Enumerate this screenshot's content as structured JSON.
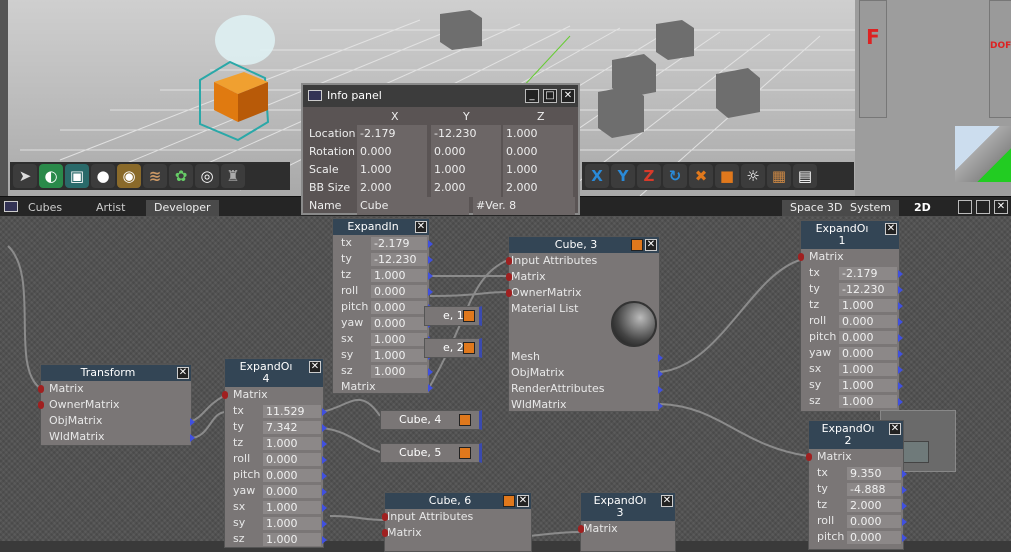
{
  "colors": {
    "accent": "#e0781c",
    "node_title": "#334555",
    "pin_in": "#a02020",
    "pin_out": "#4050e0"
  },
  "toolbar": {
    "icons": [
      "arrow-select-icon",
      "rotate-sphere-icon",
      "cube-icon",
      "bomb-icon",
      "sphere-icon",
      "grass-icon",
      "palette-icon",
      "tire-icon",
      "robot-icon"
    ],
    "right_icons": [
      "X",
      "Y",
      "Z"
    ]
  },
  "right_panel": {
    "letter": "F",
    "label1": "DOF"
  },
  "tabs": {
    "window_title": "Cubes",
    "artist": "Artist",
    "developer": "Developer",
    "space3d": "Space 3D",
    "system": "System",
    "mode2d": "2D"
  },
  "info_panel": {
    "title": "Info panel",
    "headers": [
      "X",
      "Y",
      "Z"
    ],
    "rows": [
      {
        "label": "Location",
        "x": "-2.179",
        "y": "-12.230",
        "z": "1.000"
      },
      {
        "label": "Rotation",
        "x": "0.000",
        "y": "0.000",
        "z": "0.000"
      },
      {
        "label": "Scale",
        "x": "1.000",
        "y": "1.000",
        "z": "1.000"
      },
      {
        "label": "BB Size",
        "x": "2.000",
        "y": "2.000",
        "z": "2.000"
      }
    ],
    "name_label": "Name",
    "name_value": "Cube",
    "version": "#Ver. 8"
  },
  "nodes": {
    "transform": {
      "title": "Transform",
      "ports": [
        "Matrix",
        "OwnerMatrix",
        "ObjMatrix",
        "WldMatrix"
      ]
    },
    "expand_in": {
      "title": "ExpandIn",
      "params": [
        [
          "tx",
          "-2.179"
        ],
        [
          "ty",
          "-12.230"
        ],
        [
          "tz",
          "1.000"
        ],
        [
          "roll",
          "0.000"
        ],
        [
          "pitch",
          "0.000"
        ],
        [
          "yaw",
          "0.000"
        ],
        [
          "sx",
          "1.000"
        ],
        [
          "sy",
          "1.000"
        ],
        [
          "sz",
          "1.000"
        ]
      ],
      "out": "Matrix"
    },
    "expand4": {
      "title": "ExpandOı",
      "num": "4",
      "matrix": "Matrix",
      "params": [
        [
          "tx",
          "11.529"
        ],
        [
          "ty",
          "7.342"
        ],
        [
          "tz",
          "1.000"
        ],
        [
          "roll",
          "0.000"
        ],
        [
          "pitch",
          "0.000"
        ],
        [
          "yaw",
          "0.000"
        ],
        [
          "sx",
          "1.000"
        ],
        [
          "sy",
          "1.000"
        ],
        [
          "sz",
          "1.000"
        ]
      ]
    },
    "expand1": {
      "title": "ExpandOı",
      "num": "1",
      "matrix": "Matrix",
      "params": [
        [
          "tx",
          "-2.179"
        ],
        [
          "ty",
          "-12.230"
        ],
        [
          "tz",
          "1.000"
        ],
        [
          "roll",
          "0.000"
        ],
        [
          "pitch",
          "0.000"
        ],
        [
          "yaw",
          "0.000"
        ],
        [
          "sx",
          "1.000"
        ],
        [
          "sy",
          "1.000"
        ],
        [
          "sz",
          "1.000"
        ]
      ]
    },
    "expand2": {
      "title": "ExpandOı",
      "num": "2",
      "matrix": "Matrix",
      "params": [
        [
          "tx",
          "9.350"
        ],
        [
          "ty",
          "-4.888"
        ],
        [
          "tz",
          "2.000"
        ],
        [
          "roll",
          "0.000"
        ],
        [
          "pitch",
          "0.000"
        ]
      ]
    },
    "expand3": {
      "title": "ExpandOı",
      "num": "3",
      "matrix": "Matrix"
    },
    "cube3": {
      "title": "Cube, 3",
      "ports": [
        "Input Attributes",
        "Matrix",
        "OwnerMatrix",
        "Material List"
      ],
      "ports2": [
        "Mesh",
        "ObjMatrix",
        "RenderAttributes",
        "WldMatrix"
      ]
    },
    "cube6": {
      "title": "Cube, 6",
      "ports": [
        "Input Attributes",
        "Matrix"
      ]
    },
    "cube1": {
      "title": "e, 1"
    },
    "cube2": {
      "title": "e, 2"
    },
    "cube4": {
      "title": "Cube, 4"
    },
    "cube5": {
      "title": "Cube, 5"
    }
  }
}
